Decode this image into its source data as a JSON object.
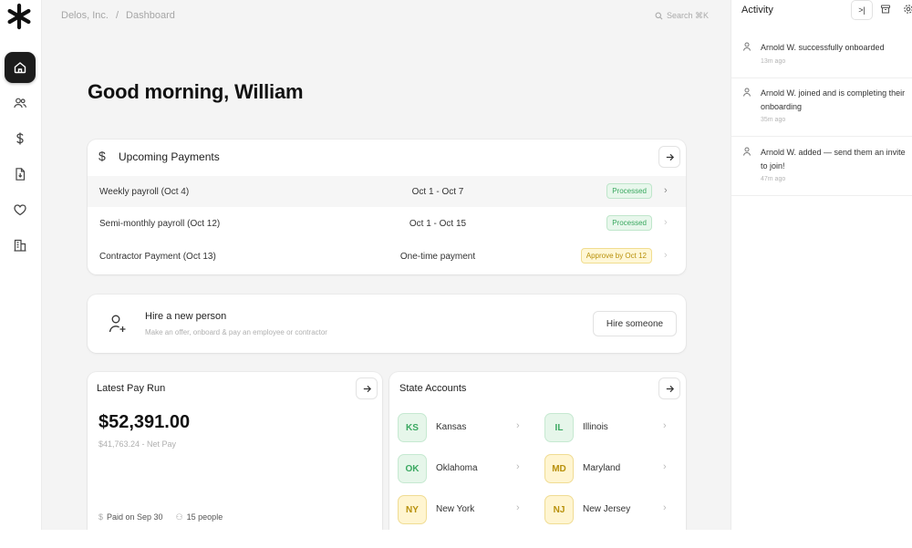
{
  "breadcrumb": {
    "org": "Delos, Inc.",
    "separator": "/",
    "page": "Dashboard"
  },
  "search": {
    "placeholder": "Search ⌘K"
  },
  "greeting": "Good morning, William",
  "payments": {
    "title": "Upcoming Payments",
    "rows": [
      {
        "name": "Weekly payroll (Oct 4)",
        "period": "Oct 1 - Oct 7",
        "status": "Processed",
        "status_type": "green"
      },
      {
        "name": "Semi-monthly payroll (Oct 12)",
        "period": "Oct 1 - Oct 15",
        "status": "Processed",
        "status_type": "green"
      },
      {
        "name": "Contractor Payment (Oct 13)",
        "period": "One-time payment",
        "status": "Approve by Oct 12",
        "status_type": "yellow"
      }
    ]
  },
  "hire": {
    "title": "Hire a new person",
    "subtitle": "Make an offer, onboard & pay an employee or contractor",
    "button": "Hire someone"
  },
  "payrun": {
    "title": "Latest Pay Run",
    "amount": "$52,391.00",
    "net": "$41,763.24 - Net Pay",
    "paid_on": "Paid on Sep 30",
    "people": "15 people"
  },
  "states": {
    "title": "State Accounts",
    "items": [
      {
        "code": "KS",
        "name": "Kansas",
        "color": "green"
      },
      {
        "code": "IL",
        "name": "Illinois",
        "color": "green"
      },
      {
        "code": "OK",
        "name": "Oklahoma",
        "color": "green"
      },
      {
        "code": "MD",
        "name": "Maryland",
        "color": "yellow"
      },
      {
        "code": "NY",
        "name": "New York",
        "color": "yellow"
      },
      {
        "code": "NJ",
        "name": "New Jersey",
        "color": "yellow"
      }
    ]
  },
  "activity": {
    "title": "Activity",
    "items": [
      {
        "text": "Arnold W. successfully onboarded",
        "time": "13m ago"
      },
      {
        "text": "Arnold W. joined and is completing their onboarding",
        "time": "35m ago"
      },
      {
        "text": "Arnold W. added — send them an invite to join!",
        "time": "47m ago"
      }
    ]
  },
  "icons": {
    "nav": [
      "home-icon",
      "users-icon",
      "dollar-icon",
      "document-icon",
      "heart-icon",
      "building-icon"
    ]
  },
  "colors": {
    "accent": "#1c1c1c",
    "processed": "#3aa860",
    "pending": "#b8900a"
  }
}
